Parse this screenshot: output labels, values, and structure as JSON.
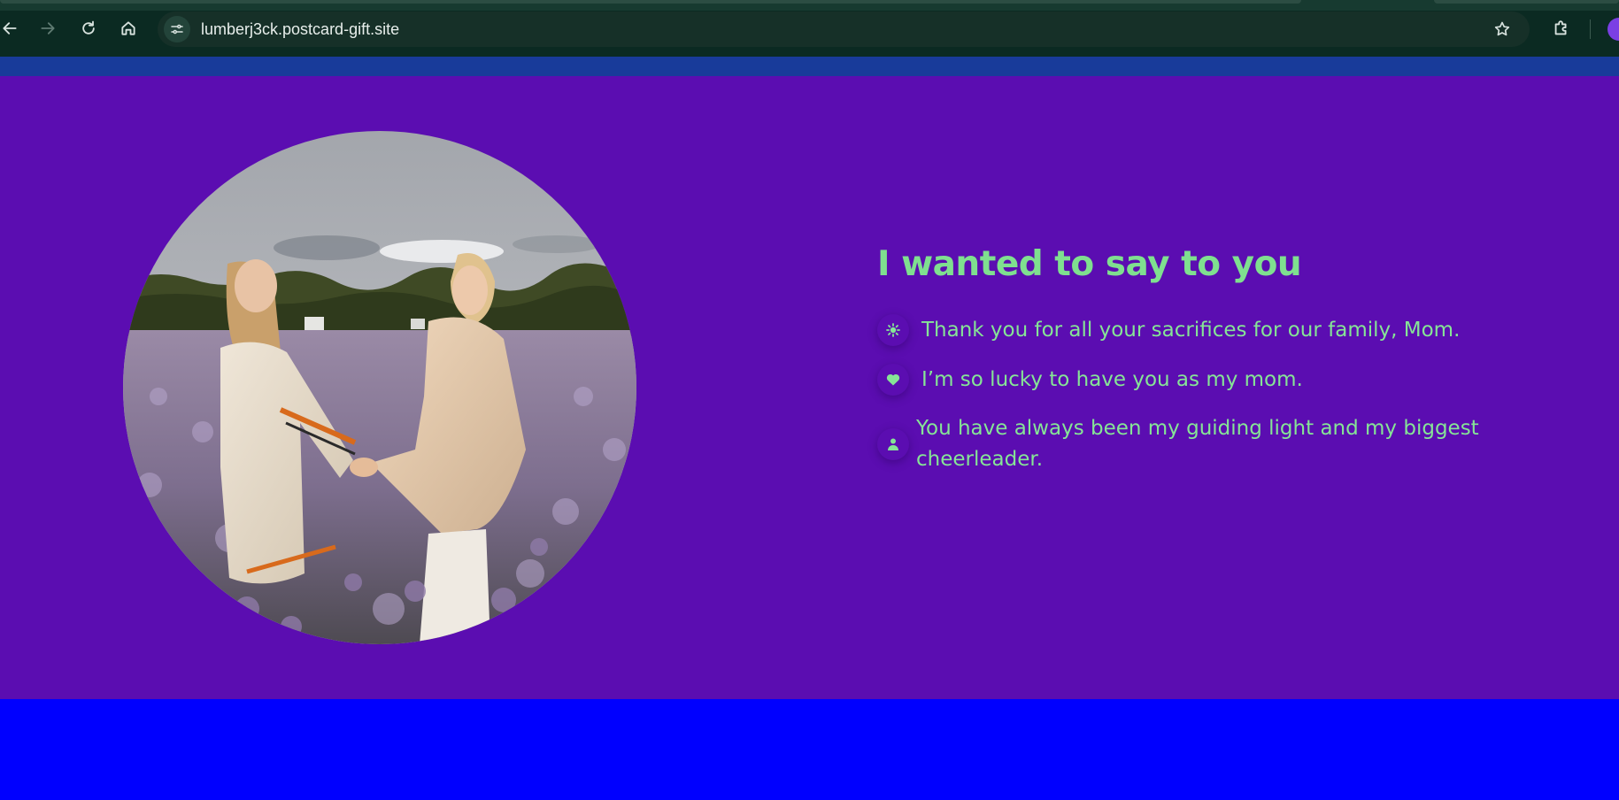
{
  "browser": {
    "url": "lumberj3ck.postcard-gift.site",
    "icons": {
      "back": "arrow-left-icon",
      "forward": "arrow-right-icon",
      "reload": "reload-icon",
      "home": "home-icon",
      "site_info": "tune-icon",
      "bookmark": "star-icon",
      "extensions": "puzzle-icon"
    }
  },
  "page": {
    "colors": {
      "top_band": "#183b9a",
      "hero_background": "#5b0db1",
      "accent_text": "#7fe08f",
      "bottom_band": "#0000ff"
    },
    "photo": {
      "subject": "two women holding hands in a lavender flower field"
    },
    "message": {
      "heading": "I wanted to say to you",
      "items": [
        {
          "icon": "sun-icon",
          "text": "Thank you for all your sacrifices for our family, Mom."
        },
        {
          "icon": "heart-icon",
          "text": "I’m so lucky to have you as my mom."
        },
        {
          "icon": "person-icon",
          "text": "You have always been my guiding light and my biggest cheerleader."
        }
      ]
    }
  }
}
